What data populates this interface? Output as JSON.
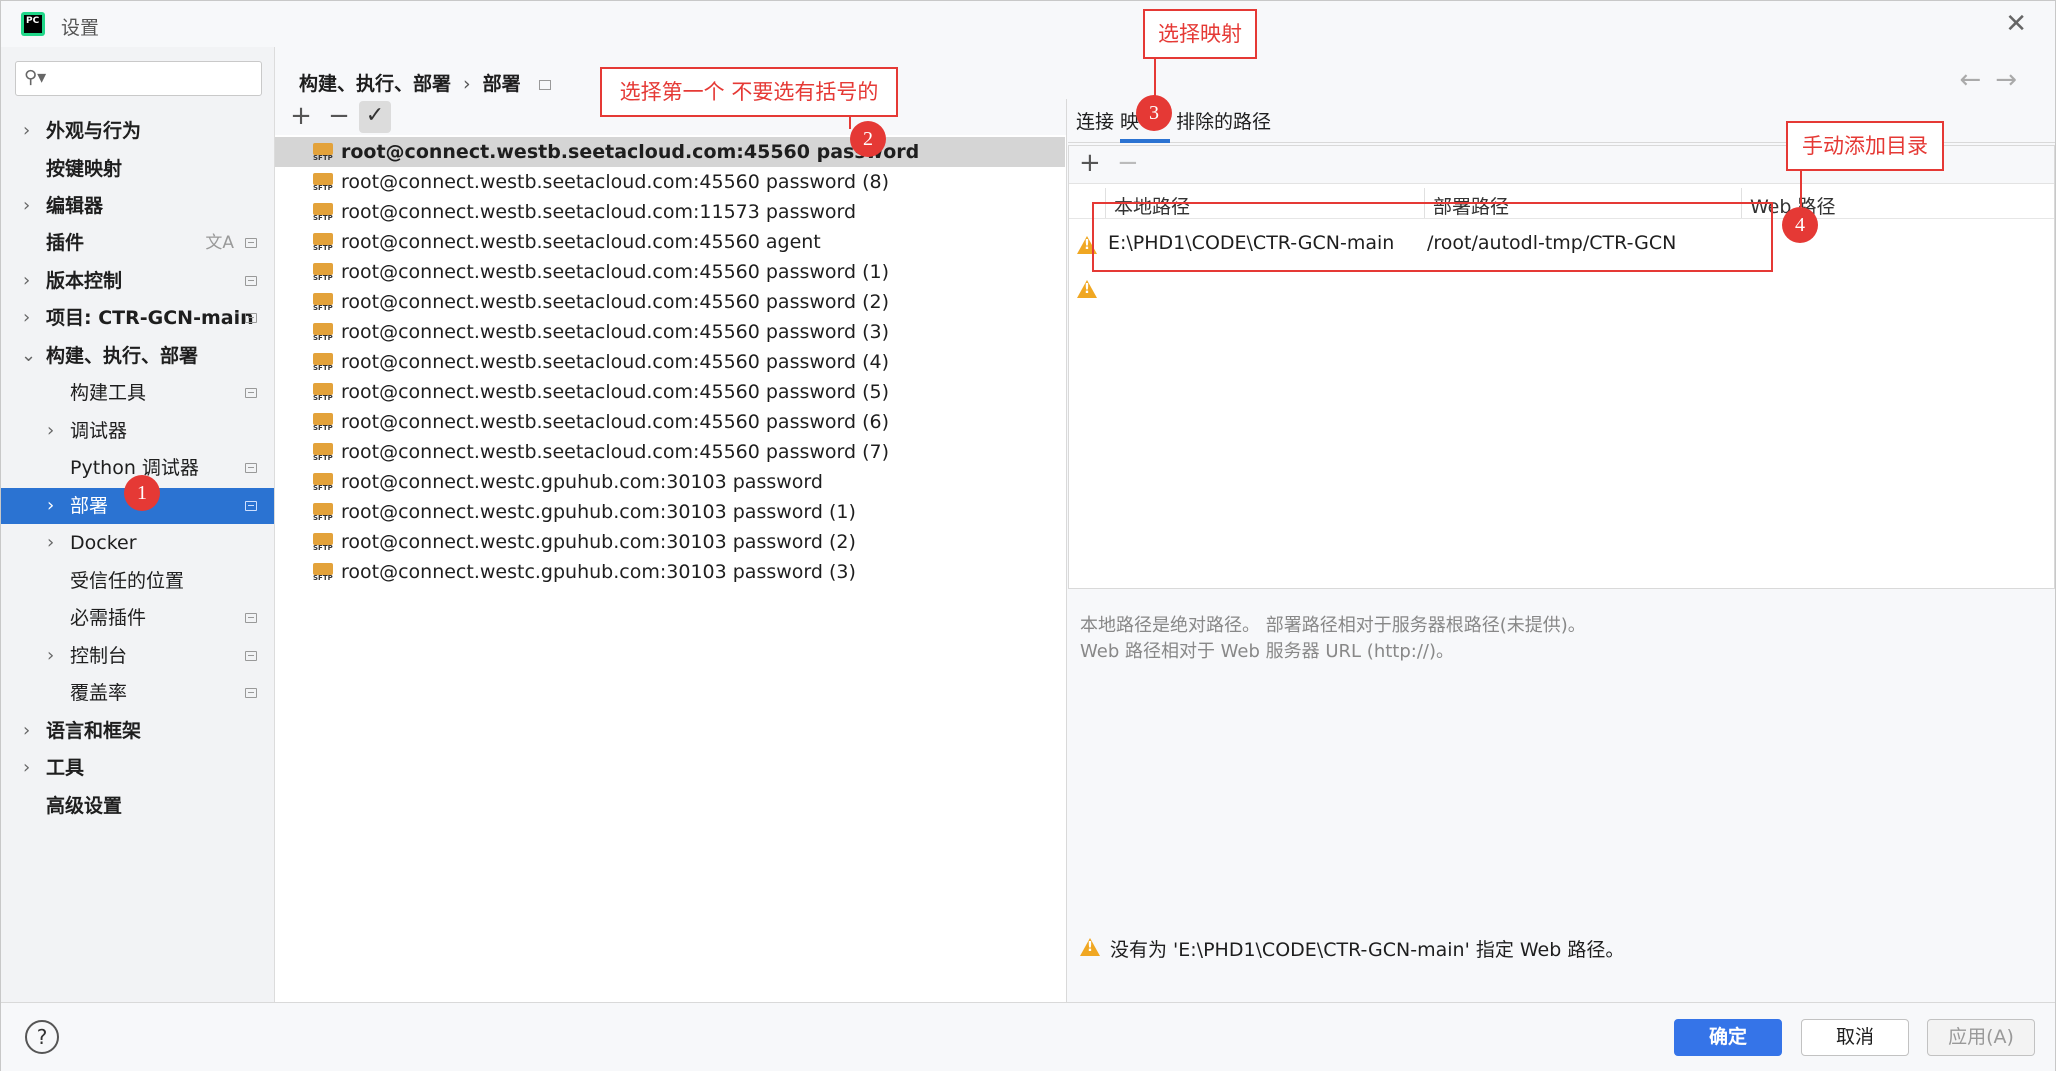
{
  "window": {
    "title": "设置",
    "app_icon_text": "PC"
  },
  "sidebar": {
    "items": [
      {
        "label": "外观与行为"
      },
      {
        "label": "按键映射"
      },
      {
        "label": "编辑器"
      },
      {
        "label": "插件"
      },
      {
        "label": "版本控制"
      },
      {
        "label": "项目: CTR-GCN-main"
      },
      {
        "label": "构建、执行、部署"
      },
      {
        "label": "构建工具"
      },
      {
        "label": "调试器"
      },
      {
        "label": "Python 调试器"
      },
      {
        "label": "部署"
      },
      {
        "label": "Docker"
      },
      {
        "label": "受信任的位置"
      },
      {
        "label": "必需插件"
      },
      {
        "label": "控制台"
      },
      {
        "label": "覆盖率"
      },
      {
        "label": "语言和框架"
      },
      {
        "label": "工具"
      },
      {
        "label": "高级设置"
      }
    ]
  },
  "breadcrumb": {
    "parent": "构建、执行、部署",
    "sep": "›",
    "current": "部署"
  },
  "list_toolbar": {
    "add": "+",
    "remove": "−",
    "check": "✓"
  },
  "servers": [
    {
      "name": "root@connect.westb.seetacloud.com:45560 password",
      "icon": "SFTP"
    },
    {
      "name": "root@connect.westb.seetacloud.com:45560 password (8)",
      "icon": "SFTP"
    },
    {
      "name": "root@connect.westb.seetacloud.com:11573 password",
      "icon": "SFTP"
    },
    {
      "name": "root@connect.westb.seetacloud.com:45560 agent",
      "icon": "SFTP"
    },
    {
      "name": "root@connect.westb.seetacloud.com:45560 password (1)",
      "icon": "SFTP"
    },
    {
      "name": "root@connect.westb.seetacloud.com:45560 password (2)",
      "icon": "SFTP"
    },
    {
      "name": "root@connect.westb.seetacloud.com:45560 password (3)",
      "icon": "SFTP"
    },
    {
      "name": "root@connect.westb.seetacloud.com:45560 password (4)",
      "icon": "SFTP"
    },
    {
      "name": "root@connect.westb.seetacloud.com:45560 password (5)",
      "icon": "SFTP"
    },
    {
      "name": "root@connect.westb.seetacloud.com:45560 password (6)",
      "icon": "SFTP"
    },
    {
      "name": "root@connect.westb.seetacloud.com:45560 password (7)",
      "icon": "SFTP"
    },
    {
      "name": "root@connect.westc.gpuhub.com:30103 password",
      "icon": "SFTP"
    },
    {
      "name": "root@connect.westc.gpuhub.com:30103 password (1)",
      "icon": "SFTP"
    },
    {
      "name": "root@connect.westc.gpuhub.com:30103 password (2)",
      "icon": "SFTP"
    },
    {
      "name": "root@connect.westc.gpuhub.com:30103 password (3)",
      "icon": "SFTP"
    }
  ],
  "tabs": {
    "connection": "连接",
    "mapping": "映",
    "excluded": "排除的路径"
  },
  "mapping": {
    "add": "+",
    "remove": "−",
    "columns": {
      "local": "本地路径",
      "deploy": "部署路径",
      "web": "Web 路径"
    },
    "row": {
      "local": "E:\\PHD1\\CODE\\CTR-GCN-main",
      "deploy": "/root/autodl-tmp/CTR-GCN"
    }
  },
  "help": {
    "line1": "本地路径是绝对路径。 部署路径相对于服务器根路径(未提供)。",
    "line2": "Web 路径相对于 Web 服务器 URL (http://)。"
  },
  "warning": "没有为 'E:\\PHD1\\CODE\\CTR-GCN-main' 指定 Web 路径。",
  "footer": {
    "help": "?",
    "ok": "确定",
    "cancel": "取消",
    "apply": "应用(A)"
  },
  "annotations": {
    "note2": "选择第一个 不要选有括号的",
    "note3": "选择映射",
    "note4": "手动添加目录",
    "n1": "1",
    "n2": "2",
    "n3": "3",
    "n4": "4"
  },
  "colors": {
    "accent": "#2b73d2",
    "annotation": "#e53935",
    "warning": "#f0a722",
    "sftp": "#e3a23a"
  }
}
